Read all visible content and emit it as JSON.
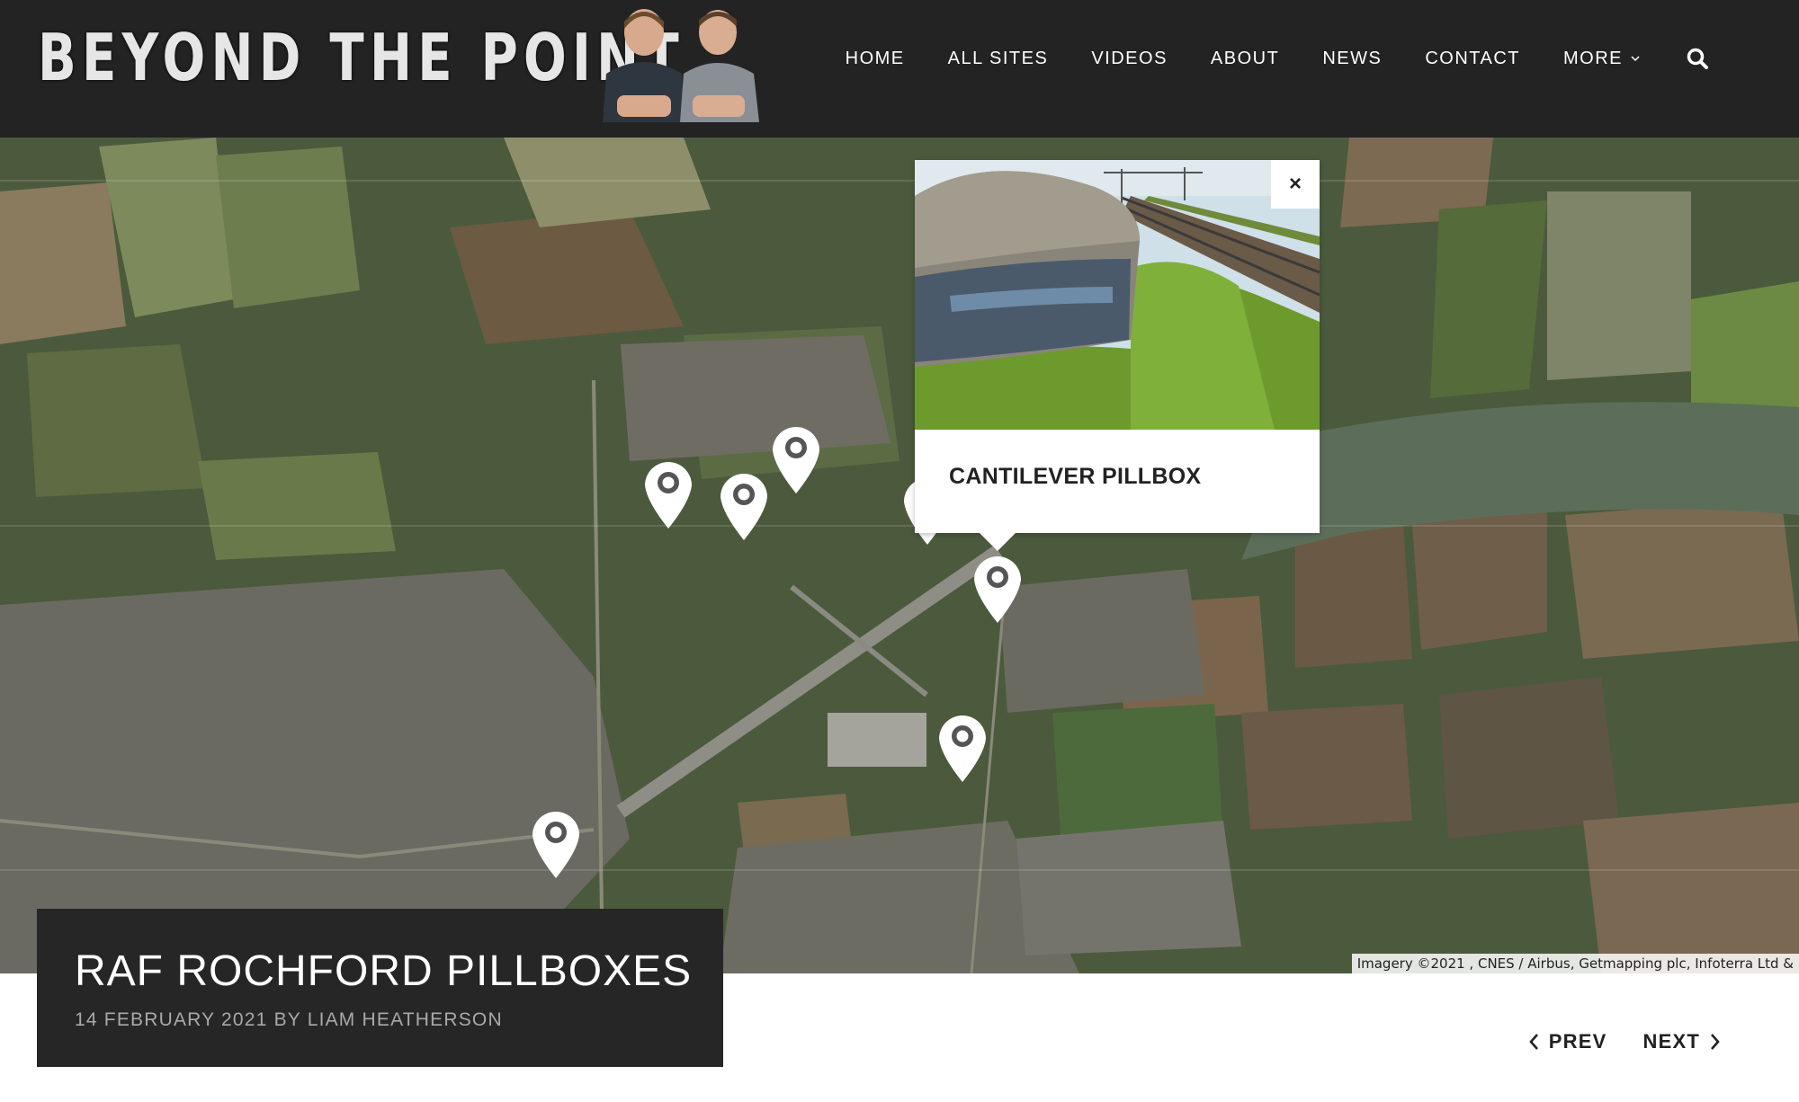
{
  "site": {
    "logo_text": "BEYOND THE POINT"
  },
  "nav": {
    "items": [
      {
        "label": "HOME"
      },
      {
        "label": "ALL SITES"
      },
      {
        "label": "VIDEOS"
      },
      {
        "label": "ABOUT"
      },
      {
        "label": "NEWS"
      },
      {
        "label": "CONTACT"
      },
      {
        "label": "MORE"
      }
    ],
    "search_icon": "search-icon"
  },
  "map": {
    "markers_count": 7,
    "attribution": "Imagery ©2021 , CNES / Airbus, Getmapping plc, Infoterra Ltd &",
    "popup": {
      "title": "CANTILEVER PILLBOX",
      "close_label": "×"
    }
  },
  "post": {
    "title": "RAF ROCHFORD PILLBOXES",
    "date": "14 FEBRUARY 2021",
    "by": "BY",
    "author": "LIAM HEATHERSON"
  },
  "pager": {
    "prev_label": "PREV",
    "next_label": "NEXT"
  },
  "colors": {
    "header_bg": "#232323",
    "card_bg": "#262626",
    "marker": "#ffffff"
  }
}
